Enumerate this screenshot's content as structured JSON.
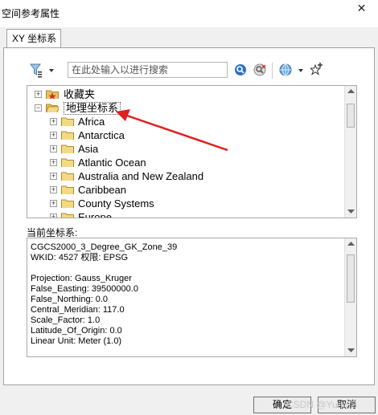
{
  "window": {
    "title": "空间参考属性",
    "close_glyph": "✕"
  },
  "tabs": [
    {
      "label": "XY 坐标系"
    }
  ],
  "toolbar": {
    "search_placeholder": "在此处输入以进行搜索"
  },
  "tree": {
    "nodes": [
      {
        "label": "收藏夹",
        "expander": "+"
      },
      {
        "label": "地理坐标系",
        "expander": "−"
      },
      {
        "label": "Africa",
        "expander": "+"
      },
      {
        "label": "Antarctica",
        "expander": "+"
      },
      {
        "label": "Asia",
        "expander": "+"
      },
      {
        "label": "Atlantic Ocean",
        "expander": "+"
      },
      {
        "label": "Australia and New Zealand",
        "expander": "+"
      },
      {
        "label": "Caribbean",
        "expander": "+"
      },
      {
        "label": "County Systems",
        "expander": "+"
      },
      {
        "label": "Europe",
        "expander": "+"
      }
    ]
  },
  "current_cs": {
    "label": "当前坐标系:",
    "lines": [
      "CGCS2000_3_Degree_GK_Zone_39",
      "WKID: 4527 权限: EPSG",
      "",
      "Projection: Gauss_Kruger",
      "False_Easting: 39500000.0",
      "False_Northing: 0.0",
      "Central_Meridian: 117.0",
      "Scale_Factor: 1.0",
      "Latitude_Of_Origin: 0.0",
      "Linear Unit: Meter (1.0)"
    ]
  },
  "buttons": {
    "ok": "确定",
    "cancel": "取消"
  },
  "watermark": "CSDN @Yuan S",
  "colors": {
    "annotation_arrow": "#e02020",
    "folder": "#e8c060",
    "search_blue": "#2b72c8"
  }
}
